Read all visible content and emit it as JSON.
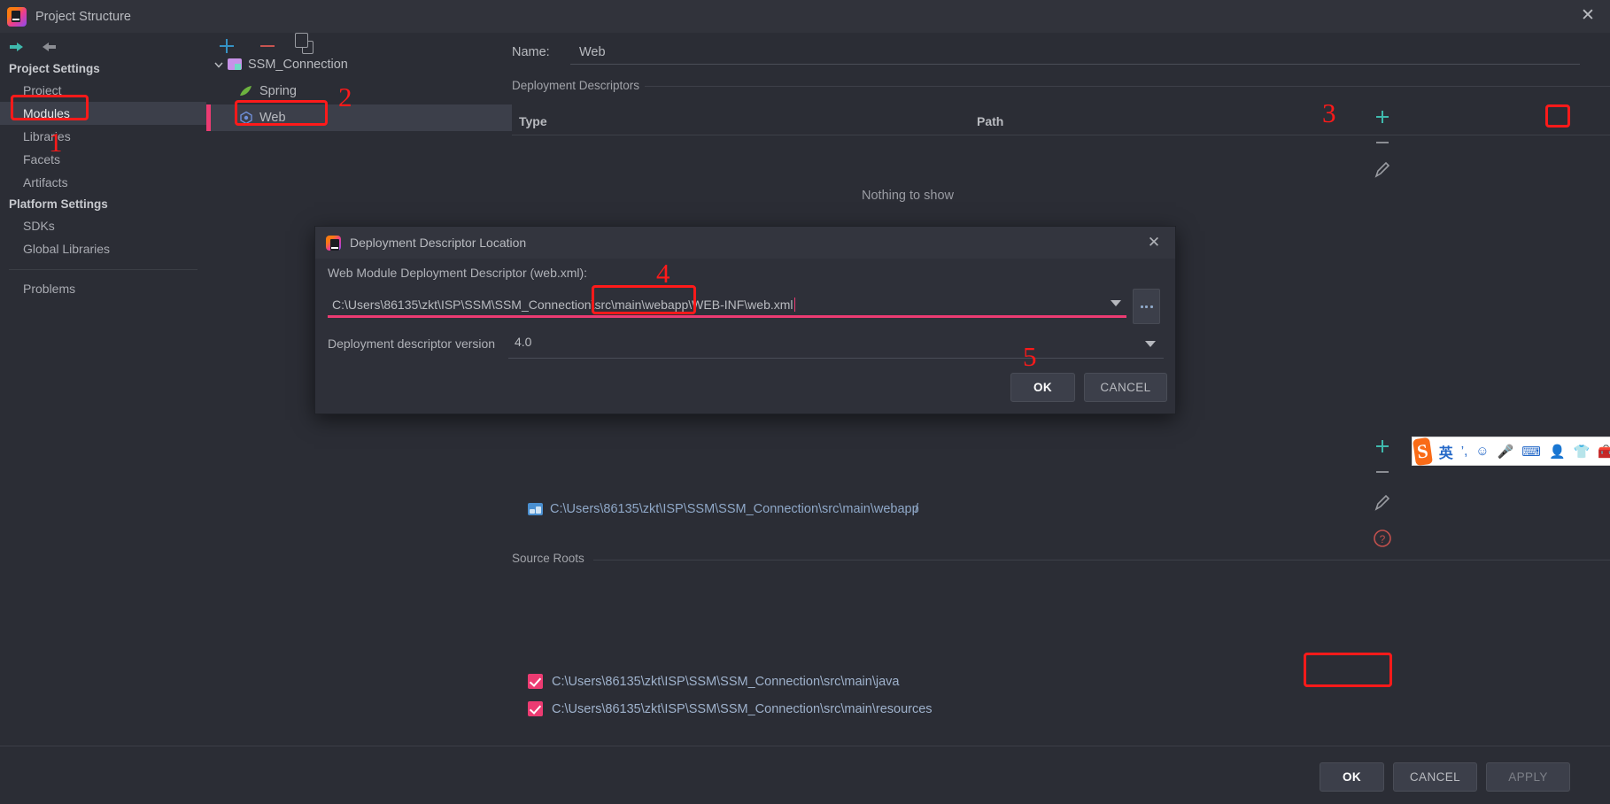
{
  "window": {
    "title": "Project Structure",
    "close_icon": "close-icon",
    "app_icon": "intellij-idea-logo"
  },
  "sidebar": {
    "back_icon": "back-arrow-icon",
    "forward_icon": "forward-arrow-icon",
    "groups": [
      {
        "header": "Project Settings",
        "items": [
          {
            "label": "Project",
            "selected": false
          },
          {
            "label": "Modules",
            "selected": true
          },
          {
            "label": "Libraries",
            "selected": false
          },
          {
            "label": "Facets",
            "selected": false
          },
          {
            "label": "Artifacts",
            "selected": false
          }
        ]
      },
      {
        "header": "Platform Settings",
        "items": [
          {
            "label": "SDKs",
            "selected": false
          },
          {
            "label": "Global Libraries",
            "selected": false
          }
        ]
      }
    ],
    "extra_items": [
      {
        "label": "Problems",
        "selected": false
      }
    ],
    "help_icon": "help-question-icon"
  },
  "tree": {
    "toolbar": [
      {
        "name": "add-button",
        "icon": "plus-icon"
      },
      {
        "name": "remove-button",
        "icon": "minus-icon"
      },
      {
        "name": "copy-button",
        "icon": "copy-icon"
      }
    ],
    "nodes": [
      {
        "label": "SSM_Connection",
        "icon": "module-folder-icon",
        "level": 0,
        "expanded": true,
        "selected": false
      },
      {
        "label": "Spring",
        "icon": "spring-leaf-icon",
        "level": 1,
        "expanded": false,
        "selected": false
      },
      {
        "label": "Web",
        "icon": "web-facet-icon",
        "level": 1,
        "expanded": false,
        "selected": true
      }
    ]
  },
  "detail": {
    "name_label": "Name:",
    "name_value": "Web",
    "deployment_section": "Deployment Descriptors",
    "table": {
      "columns": [
        "Type",
        "Path"
      ],
      "empty_text": "Nothing to show"
    },
    "web_resource_rows": [
      {
        "path": "C:\\Users\\86135\\zkt\\ISP\\SSM\\SSM_Connection\\src\\main\\webapp",
        "mapping": "/",
        "icon": "web-resource-folder-icon"
      }
    ],
    "source_roots_section": "Source Roots",
    "source_roots": [
      {
        "path": "C:\\Users\\86135\\zkt\\ISP\\SSM\\SSM_Connection\\src\\main\\java",
        "checked": true
      },
      {
        "path": "C:\\Users\\86135\\zkt\\ISP\\SSM\\SSM_Connection\\src\\main\\resources",
        "checked": true
      }
    ],
    "rail": {
      "add_icon": "plus-icon",
      "remove_icon": "minus-icon",
      "edit_icon": "pencil-icon",
      "add_icon_2": "plus-icon",
      "remove_icon_2": "minus-icon",
      "edit_icon_2": "pencil-icon",
      "help_icon": "help-question-icon"
    }
  },
  "dialog": {
    "title": "Deployment Descriptor Location",
    "app_icon": "intellij-idea-logo",
    "close_icon": "close-icon",
    "path_label": "Web Module Deployment Descriptor (web.xml):",
    "path_value": "C:\\Users\\86135\\zkt\\ISP\\SSM\\SSM_Connection\\src\\main\\webapp\\WEB-INF\\web.xml",
    "path_dropdown_icon": "chevron-down-icon",
    "browse_icon": "ellipsis-icon",
    "version_label": "Deployment descriptor version",
    "version_value": "4.0",
    "version_dropdown_icon": "chevron-down-icon",
    "ok_label": "OK",
    "cancel_label": "CANCEL"
  },
  "footer": {
    "ok_label": "OK",
    "cancel_label": "CANCEL",
    "apply_label": "APPLY"
  },
  "annotations": [
    {
      "num": "1"
    },
    {
      "num": "2"
    },
    {
      "num": "3"
    },
    {
      "num": "4"
    },
    {
      "num": "5"
    }
  ],
  "ime": {
    "logo_text": "S",
    "mode_text": "英",
    "icons": [
      "punctuation-icon",
      "emoji-icon",
      "microphone-icon",
      "keyboard-icon",
      "user-icon",
      "skin-icon",
      "toolbox-icon"
    ]
  },
  "colors": {
    "accent_pink": "#ec3b72",
    "annotation_red": "#ff1a1a",
    "selection": "#3c3f4a",
    "background": "#2b2d35",
    "link_blue": "#8fa8c8"
  }
}
